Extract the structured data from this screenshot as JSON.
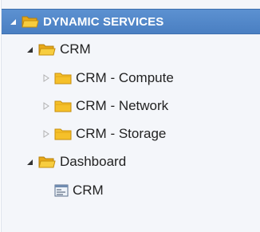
{
  "colors": {
    "selection": "#4f84c8",
    "folder": "#f5c02a",
    "folder_outline": "#c68e0d",
    "text": "#222222",
    "selected_text": "#ffffff",
    "panel_background": "#f4f6fa"
  },
  "tree": {
    "root": {
      "label": "DYNAMIC SERVICES",
      "icon": "folder-open-icon",
      "toggle": "expanded",
      "selected": true
    },
    "crm_group": {
      "label": "CRM",
      "icon": "folder-open-icon",
      "toggle": "expanded",
      "children": [
        {
          "label": "CRM - Compute",
          "icon": "folder-icon",
          "toggle": "collapsed"
        },
        {
          "label": "CRM - Network",
          "icon": "folder-icon",
          "toggle": "collapsed"
        },
        {
          "label": "CRM - Storage",
          "icon": "folder-icon",
          "toggle": "collapsed"
        }
      ]
    },
    "dashboard_group": {
      "label": "Dashboard",
      "icon": "folder-open-icon",
      "toggle": "expanded",
      "children": [
        {
          "label": "CRM",
          "icon": "dashboard-document-icon"
        }
      ]
    }
  }
}
